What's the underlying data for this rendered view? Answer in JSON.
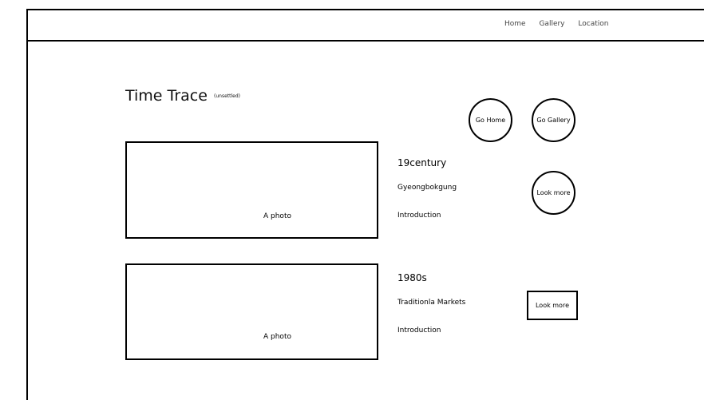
{
  "nav": {
    "items": [
      {
        "label": "Home"
      },
      {
        "label": "Gallery"
      },
      {
        "label": "Location"
      }
    ]
  },
  "header": {
    "title": "Time Trace",
    "subtitle": "(unsettled)"
  },
  "buttons": {
    "go_home": "Go Home",
    "go_gallery": "Go Gallery"
  },
  "entries": [
    {
      "photo_label": "A photo",
      "era": "19century",
      "place": "Gyeongbokgung",
      "intro": "Introduction",
      "more_label": "Look more"
    },
    {
      "photo_label": "A photo",
      "era": "1980s",
      "place": "Traditionla Markets",
      "intro": "Introduction",
      "more_label": "Look more"
    }
  ]
}
